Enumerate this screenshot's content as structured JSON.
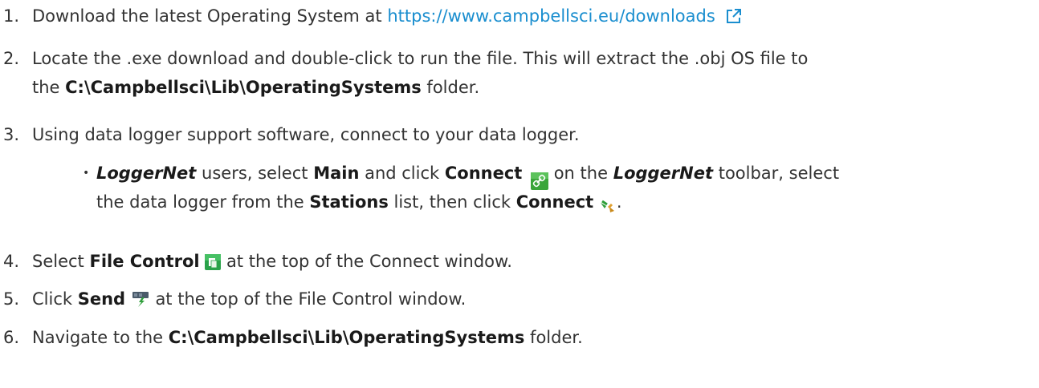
{
  "steps": [
    {
      "number": "1.",
      "text_before_link": "Download the latest Operating System at ",
      "link_text": "https://www.campbellsci.eu/downloads",
      "icon": "external-link-icon"
    },
    {
      "number": "2.",
      "line1": "Locate the .exe download and double-click to run the file. This will extract the .obj OS file to",
      "line2_before": "the ",
      "line2_path": "C:\\Campbellsci\\Lib\\OperatingSystems",
      "line2_after": " folder."
    },
    {
      "number": "3.",
      "text": "Using data logger support software, connect to your data logger.",
      "sub": {
        "bullet": "•",
        "loggernet_1": "LoggerNet",
        "users_select": " users, select ",
        "main": "Main",
        "and_click": " and click ",
        "connect_1": "Connect",
        "connect_icon": "link-icon",
        "on_the": " on the ",
        "loggernet_2": "LoggerNet",
        "toolbar_select": " toolbar, select",
        "line2_before": "the data logger from the ",
        "stations": "Stations",
        "list_then": " list, then click ",
        "connect_2": "Connect",
        "plug_icon": "plug-icon",
        "period": "."
      }
    },
    {
      "number": "4.",
      "select": "Select ",
      "file_control": "File Control",
      "icon": "file-control-icon",
      "after": " at the top of the Connect window."
    },
    {
      "number": "5.",
      "click": "Click ",
      "send": "Send",
      "icon": "send-icon",
      "after": " at the top of the File Control window."
    },
    {
      "number": "6.",
      "before": "Navigate to the ",
      "path": "C:\\Campbellsci\\Lib\\OperatingSystems",
      "after": " folder."
    }
  ],
  "colors": {
    "text": "#333333",
    "link": "#1a8ecf",
    "icon_green": "#3aa53a"
  }
}
